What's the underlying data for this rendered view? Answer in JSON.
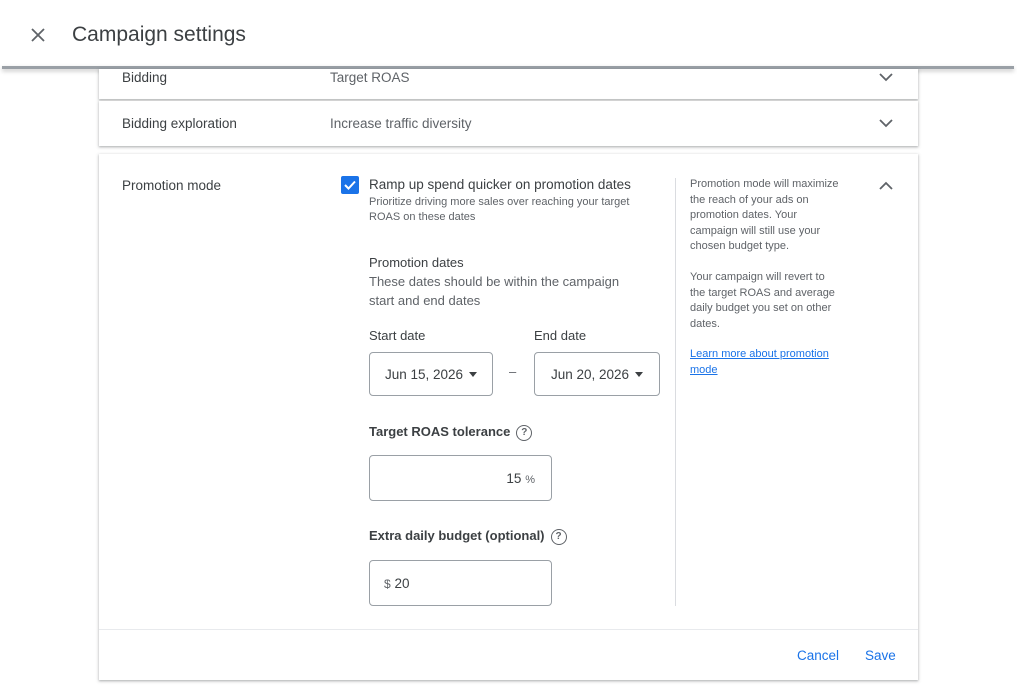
{
  "header": {
    "title": "Campaign settings",
    "close_icon": "close-icon"
  },
  "bidding": {
    "label": "Bidding",
    "value": "Target ROAS"
  },
  "bidding_exploration": {
    "label": "Bidding exploration",
    "value": "Increase traffic diversity"
  },
  "promotion": {
    "label": "Promotion mode",
    "checkbox": {
      "checked": true,
      "title": "Ramp up spend quicker on promotion dates",
      "description_line1": "Prioritize driving more sales over reaching your target",
      "description_line2": "ROAS on these dates"
    },
    "dates": {
      "heading": "Promotion dates",
      "hint_line1": "These dates should be within the campaign",
      "hint_line2": "start and end dates",
      "start_label": "Start date",
      "start_value": "Jun 15, 2026",
      "separator": "–",
      "end_label": "End date",
      "end_value": "Jun 20, 2026"
    },
    "tolerance": {
      "label": "Target ROAS tolerance",
      "value": "15",
      "unit": "%"
    },
    "extra_budget": {
      "label": "Extra daily budget (optional)",
      "currency": "$",
      "value": "20"
    },
    "help": {
      "p1_lines": [
        "Promotion mode will maximize",
        "the reach of your ads on",
        "promotion dates. Your",
        "campaign will still use your",
        "chosen budget type."
      ],
      "p2_lines": [
        "Your campaign will revert to",
        "the target ROAS and average",
        "daily budget you set on other",
        "dates."
      ],
      "link_lines": [
        "Learn more about promotion",
        "mode"
      ]
    },
    "actions": {
      "cancel": "Cancel",
      "save": "Save"
    }
  },
  "colors": {
    "accent": "#1a73e8",
    "text": "#3c4043",
    "muted": "#5f6368",
    "border": "#9aa0a6"
  }
}
